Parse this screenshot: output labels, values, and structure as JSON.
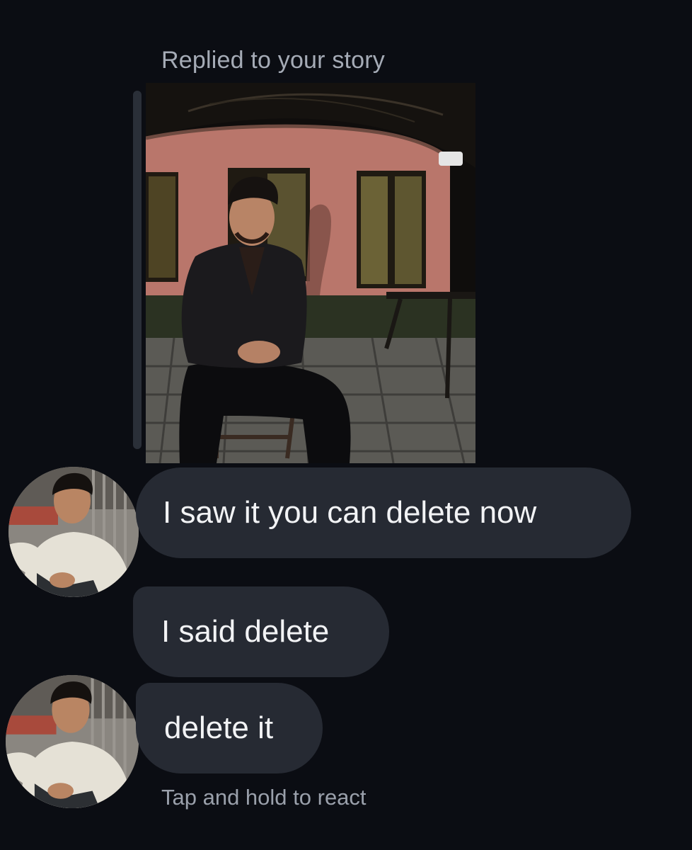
{
  "story_reply": {
    "caption": "Replied to your story",
    "thumbnail_icon": "story-photo-thumbnail"
  },
  "messages": [
    {
      "text": "I saw it you can delete now",
      "avatar": "sender-avatar"
    },
    {
      "text": "I said delete"
    },
    {
      "text": "delete it",
      "avatar": "sender-avatar"
    }
  ],
  "footer": {
    "hint": "Tap and hold to react"
  },
  "colors": {
    "background": "#0b0d13",
    "bubble": "#262a33",
    "bubble_text": "#f2f3f5",
    "secondary_text": "#a5abb6"
  }
}
